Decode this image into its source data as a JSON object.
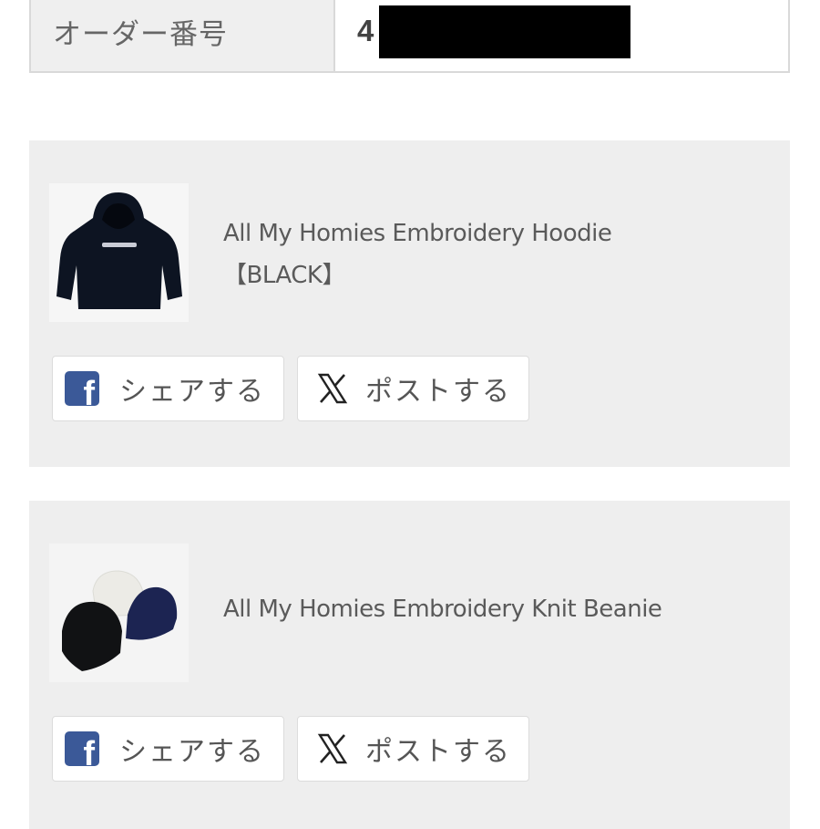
{
  "order": {
    "label": "オーダー番号",
    "value_visible": "4"
  },
  "items": [
    {
      "name_line1": "All My Homies Embroidery Hoodie",
      "name_line2": "【BLACK】",
      "share_facebook_label": "シェアする",
      "share_x_label": "ポストする"
    },
    {
      "name_line1": "All My Homies Embroidery Knit Beanie",
      "share_facebook_label": "シェアする",
      "share_x_label": "ポストする"
    }
  ],
  "icons": {
    "facebook": "facebook-icon",
    "x": "x-icon"
  },
  "colors": {
    "facebook_blue": "#3b5998",
    "card_bg": "#eeeeee",
    "redaction": "#000000"
  }
}
